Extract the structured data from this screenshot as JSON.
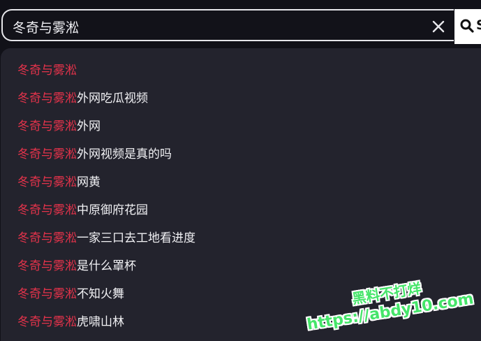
{
  "search": {
    "value": "冬奇与雾淞",
    "button_label": "S"
  },
  "icons": {
    "clear": "close-icon",
    "search": "search-icon"
  },
  "colors": {
    "highlight": "#e5334b",
    "text": "#f2f2f5",
    "dropdown_bg": "#23232d",
    "watermark": "#46e56a"
  },
  "suggestions": [
    {
      "match": "冬奇与雾淞",
      "rest": ""
    },
    {
      "match": "冬奇与雾淞",
      "rest": "外网吃瓜视频"
    },
    {
      "match": "冬奇与雾淞",
      "rest": "外网"
    },
    {
      "match": "冬奇与雾淞",
      "rest": "外网视频是真的吗"
    },
    {
      "match": "冬奇与雾淞",
      "rest": "网黄"
    },
    {
      "match": "冬奇与雾淞",
      "rest": "中原御府花园"
    },
    {
      "match": "冬奇与雾淞",
      "rest": "一家三口去工地看进度"
    },
    {
      "match": "冬奇与雾淞",
      "rest": "是什么罩杯"
    },
    {
      "match": "冬奇与雾淞",
      "rest": "不知火舞"
    },
    {
      "match": "冬奇与雾淞",
      "rest": "虎啸山林"
    }
  ],
  "watermark": {
    "line1": "黑料不打烊",
    "line2": "https://abdy10.com"
  }
}
